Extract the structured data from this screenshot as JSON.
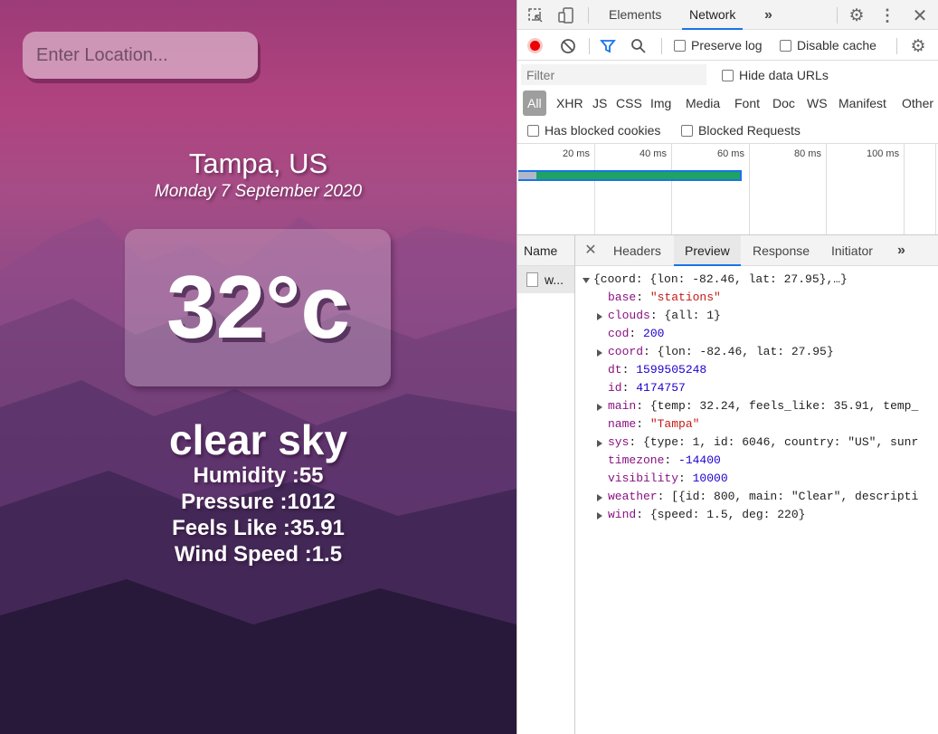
{
  "weather_app": {
    "search_placeholder": "Enter Location...",
    "city": "Tampa, US",
    "date": "Monday 7 September 2020",
    "temperature": "32°c",
    "description": "clear sky",
    "humidity": "Humidity :55",
    "pressure": "Pressure :1012",
    "feels_like": "Feels Like :35.91",
    "wind_speed": "Wind Speed :1.5"
  },
  "devtools": {
    "tabs": [
      "Elements",
      "Network"
    ],
    "more_tabs": "»",
    "toolbar": {
      "preserve_log": "Preserve log",
      "disable_cache": "Disable cache"
    },
    "filter_placeholder": "Filter",
    "hide_data_urls": "Hide data URLs",
    "types": [
      "All",
      "XHR",
      "JS",
      "CSS",
      "Img",
      "Media",
      "Font",
      "Doc",
      "WS",
      "Manifest",
      "Other"
    ],
    "has_blocked_cookies": "Has blocked cookies",
    "blocked_requests": "Blocked Requests",
    "timeline_ticks": [
      "20 ms",
      "40 ms",
      "60 ms",
      "80 ms",
      "100 ms"
    ],
    "name_header": "Name",
    "request_name": "w...",
    "detail_tabs": [
      "Headers",
      "Preview",
      "Response",
      "Initiator"
    ],
    "active_detail_tab": "Preview",
    "preview": {
      "root": "{coord: {lon: -82.46, lat: 27.95},…}",
      "lines": [
        {
          "key": "base",
          "value": "\"stations\"",
          "type": "str",
          "expandable": false
        },
        {
          "key": "clouds",
          "value": "{all: 1}",
          "type": "obj",
          "expandable": true
        },
        {
          "key": "cod",
          "value": "200",
          "type": "num",
          "expandable": false
        },
        {
          "key": "coord",
          "value": "{lon: -82.46, lat: 27.95}",
          "type": "obj",
          "expandable": true
        },
        {
          "key": "dt",
          "value": "1599505248",
          "type": "num",
          "expandable": false
        },
        {
          "key": "id",
          "value": "4174757",
          "type": "num",
          "expandable": false
        },
        {
          "key": "main",
          "value": "{temp: 32.24, feels_like: 35.91, temp_",
          "type": "obj",
          "expandable": true
        },
        {
          "key": "name",
          "value": "\"Tampa\"",
          "type": "str",
          "expandable": false
        },
        {
          "key": "sys",
          "value": "{type: 1, id: 6046, country: \"US\", sunr",
          "type": "obj",
          "expandable": true
        },
        {
          "key": "timezone",
          "value": "-14400",
          "type": "num",
          "expandable": false
        },
        {
          "key": "visibility",
          "value": "10000",
          "type": "num",
          "expandable": false
        },
        {
          "key": "weather",
          "value": "[{id: 800, main: \"Clear\", descripti",
          "type": "obj",
          "expandable": true
        },
        {
          "key": "wind",
          "value": "{speed: 1.5, deg: 220}",
          "type": "obj",
          "expandable": true
        }
      ]
    }
  }
}
